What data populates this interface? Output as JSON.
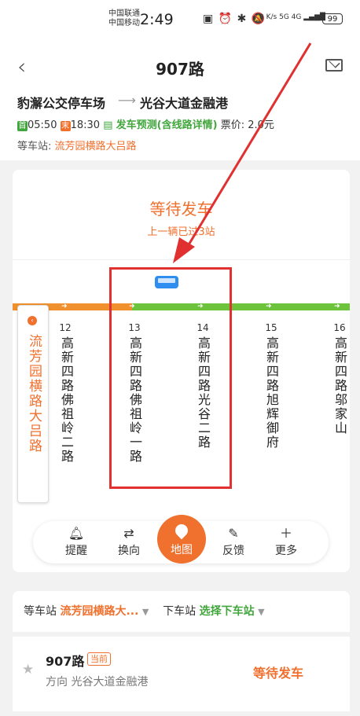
{
  "status_bar": {
    "carrier1": "中国联通",
    "carrier2": "中国移动",
    "time": "2:49",
    "net_speed": "0 K/s",
    "net_labels": "5G 4G",
    "battery": "99"
  },
  "header": {
    "title": "907路",
    "back_icon": "chevron-left-icon",
    "mail_icon": "mail-icon"
  },
  "route": {
    "from": "豹澥公交停车场",
    "arrow": "⟶",
    "to": "光谷大道金融港",
    "first_tag": "首",
    "first_time": "05:50",
    "last_tag": "末",
    "last_time": "18:30",
    "predict": "发车预测(含线路详情)",
    "fare_label": "票价:",
    "fare": "2.0元",
    "wait_label": "等车站:",
    "wait_station": "流芳园横路大吕路"
  },
  "arrival": {
    "status": "等待发车",
    "sub": "上一辆已过3站"
  },
  "stops": {
    "current": "流芳园横路大吕路",
    "list": [
      {
        "num": "12",
        "name": "高新四路佛祖岭二路"
      },
      {
        "num": "13",
        "name": "高新四路佛祖岭一路"
      },
      {
        "num": "14",
        "name": "高新四路光谷二路"
      },
      {
        "num": "15",
        "name": "高新四路旭辉御府"
      },
      {
        "num": "16",
        "name": "高新四路邬家山"
      }
    ]
  },
  "toolbar": {
    "remind": "提醒",
    "switch": "换向",
    "map": "地图",
    "feedback": "反馈",
    "more": "更多"
  },
  "bottom": {
    "wait_label": "等车站",
    "wait_station": "流芳园横路大...",
    "off_label": "下车站",
    "off_station": "选择下车站",
    "route_name": "907路",
    "badge": "当前",
    "direction": "方向 光谷大道金融港",
    "status": "等待发车"
  },
  "colors": {
    "accent": "#f0702e",
    "green": "#6dc43c",
    "annotation_red": "#e03030"
  }
}
